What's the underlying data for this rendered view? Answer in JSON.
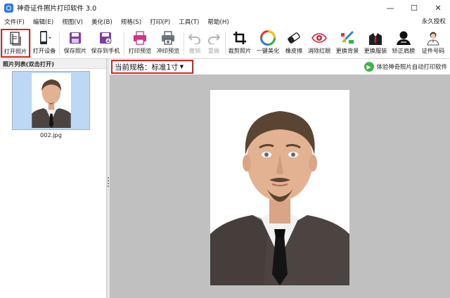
{
  "window": {
    "title": "神奇证件照片打印软件 3.0",
    "minimize": "—",
    "maximize": "☐",
    "close": "✕"
  },
  "menu": {
    "items": [
      "文件(F)",
      "编辑(E)",
      "视图(V)",
      "美化(B)",
      "规格(S)",
      "打印(P)",
      "工具(T)",
      "帮助(H)"
    ],
    "right": "永久授权"
  },
  "toolbar": {
    "open_photo": "打开照片",
    "open_device": "打开设备",
    "save_photo": "保存照片",
    "save_to_phone": "保存到手机",
    "print_preview": "打印预览",
    "develop_preview": "冲印预览",
    "undo": "撤销",
    "redo": "重做",
    "crop": "裁剪照片",
    "beautify": "一键美化",
    "eraser": "橡皮擦",
    "red_eye": "消除红眼",
    "change_bg": "更换背景",
    "change_clothes": "更换服装",
    "correct_shoulder": "矫正肩膀",
    "id_number": "证件号码"
  },
  "photo_list": {
    "header": "照片列表(双击打开)",
    "file_name": "002.jpg"
  },
  "spec": {
    "label": "当前规格：",
    "value": "标准1寸"
  },
  "promo": {
    "text": "体验神奇照片自动打印软件"
  },
  "colors": {
    "highlight": "#e02020",
    "canvas_bg": "#c0c0c0",
    "thumb_bg": "#bcd8f4",
    "accent_blue": "#2f7be0"
  }
}
